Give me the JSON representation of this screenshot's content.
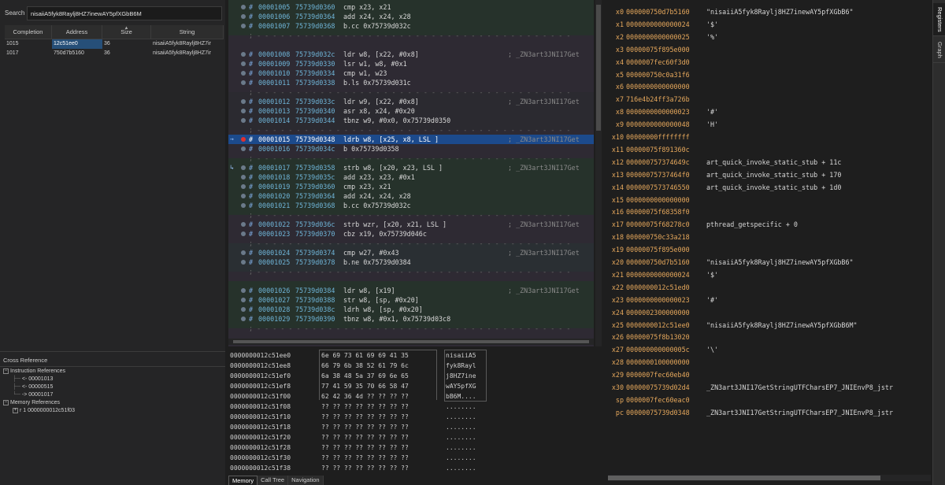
{
  "search": {
    "label": "Search",
    "value": "nisaiiA5fyk8Raylj8HZ7inewAY5pfXGbB6M"
  },
  "results": {
    "columns": [
      "Completion",
      "Address",
      "Size",
      "String"
    ],
    "rows": [
      {
        "completion": "1015",
        "address": "12c51ee0",
        "size": "36",
        "string": "nisaiiA5fyk8Raylj8HZ7ir"
      },
      {
        "completion": "1017",
        "address": "750d7b5160",
        "size": "36",
        "string": "nisaiiA5fyk8Raylj8HZ7ir"
      }
    ]
  },
  "xref": {
    "title": "Cross Reference",
    "instr_refs": "Instruction References",
    "instr_items": [
      "<- 00001013",
      "<- 00000515",
      "-> 00001017"
    ],
    "mem_refs": "Memory References",
    "mem_items": [
      "r 1 0000000012c51f03"
    ]
  },
  "disasm": [
    {
      "kind": "ins",
      "n": "00001005",
      "a": "75739d0360",
      "i": "cmp x23, x21",
      "c": ""
    },
    {
      "kind": "ins",
      "n": "00001006",
      "a": "75739d0364",
      "i": "add x24, x24, x28",
      "c": ""
    },
    {
      "kind": "ins",
      "n": "00001007",
      "a": "75739d0368",
      "i": "b.cc 0x75739d032c",
      "c": ""
    },
    {
      "kind": "sep"
    },
    {
      "kind": "blank"
    },
    {
      "kind": "ins",
      "n": "00001008",
      "a": "75739d032c",
      "i": "ldr w8, [x22, #0x8]",
      "c": "; _ZN3art3JNI17Get"
    },
    {
      "kind": "ins",
      "n": "00001009",
      "a": "75739d0330",
      "i": "lsr w1, w8, #0x1",
      "c": ""
    },
    {
      "kind": "ins",
      "n": "00001010",
      "a": "75739d0334",
      "i": "cmp w1, w23",
      "c": ""
    },
    {
      "kind": "ins",
      "n": "00001011",
      "a": "75739d0338",
      "i": "b.ls 0x75739d031c",
      "c": ""
    },
    {
      "kind": "sep"
    },
    {
      "kind": "ins",
      "n": "00001012",
      "a": "75739d033c",
      "i": "ldr w9, [x22, #0x8]",
      "c": "; _ZN3art3JNI17Get"
    },
    {
      "kind": "ins",
      "n": "00001013",
      "a": "75739d0340",
      "i": "asr x8, x24, #0x20",
      "c": ""
    },
    {
      "kind": "ins",
      "n": "00001014",
      "a": "75739d0344",
      "i": "tbnz w9, #0x0, 0x75739d0350",
      "c": ""
    },
    {
      "kind": "sep"
    },
    {
      "kind": "ins",
      "n": "00001015",
      "a": "75739d0348",
      "i": "ldrb w8, [x25, x8, LSL ]",
      "c": "; _ZN3art3JNI17Get",
      "sel": true
    },
    {
      "kind": "ins",
      "n": "00001016",
      "a": "75739d034c",
      "i": "b 0x75739d0358",
      "c": ""
    },
    {
      "kind": "sep"
    },
    {
      "kind": "ins",
      "n": "00001017",
      "a": "75739d0358",
      "i": "strb w8, [x20, x23, LSL ]",
      "c": "; _ZN3art3JNI17Get"
    },
    {
      "kind": "ins",
      "n": "00001018",
      "a": "75739d035c",
      "i": "add x23, x23, #0x1",
      "c": ""
    },
    {
      "kind": "ins",
      "n": "00001019",
      "a": "75739d0360",
      "i": "cmp x23, x21",
      "c": ""
    },
    {
      "kind": "ins",
      "n": "00001020",
      "a": "75739d0364",
      "i": "add x24, x24, x28",
      "c": ""
    },
    {
      "kind": "ins",
      "n": "00001021",
      "a": "75739d0368",
      "i": "b.cc 0x75739d032c",
      "c": ""
    },
    {
      "kind": "sep"
    },
    {
      "kind": "ins",
      "n": "00001022",
      "a": "75739d036c",
      "i": "strb wzr, [x20, x21, LSL ]",
      "c": "; _ZN3art3JNI17Get"
    },
    {
      "kind": "ins",
      "n": "00001023",
      "a": "75739d0370",
      "i": "cbz x19, 0x75739d046c",
      "c": ""
    },
    {
      "kind": "sep"
    },
    {
      "kind": "ins",
      "n": "00001024",
      "a": "75739d0374",
      "i": "cmp w27, #0x43",
      "c": "; _ZN3art3JNI17Get"
    },
    {
      "kind": "ins",
      "n": "00001025",
      "a": "75739d0378",
      "i": "b.ne 0x75739d0384",
      "c": ""
    },
    {
      "kind": "sep"
    },
    {
      "kind": "blank"
    },
    {
      "kind": "ins",
      "n": "00001026",
      "a": "75739d0384",
      "i": "ldr w8, [x19]",
      "c": "; _ZN3art3JNI17Get"
    },
    {
      "kind": "ins",
      "n": "00001027",
      "a": "75739d0388",
      "i": "str w8, [sp, #0x20]",
      "c": ""
    },
    {
      "kind": "ins",
      "n": "00001028",
      "a": "75739d038c",
      "i": "ldrh w8, [sp, #0x20]",
      "c": ""
    },
    {
      "kind": "ins",
      "n": "00001029",
      "a": "75739d0390",
      "i": "tbnz w8, #0x1, 0x75739d03c8",
      "c": ""
    },
    {
      "kind": "sep"
    }
  ],
  "memory": {
    "rows": [
      {
        "addr": "0000000012c51ee0",
        "hex": "6e 69 73 61 69 69 41 35",
        "ascii": "nisaiiA5"
      },
      {
        "addr": "0000000012c51ee8",
        "hex": "66 79 6b 38 52 61 79 6c",
        "ascii": "fyk8Rayl"
      },
      {
        "addr": "0000000012c51ef0",
        "hex": "6a 38 48 5a 37 69 6e 65",
        "ascii": "j8HZ7ine"
      },
      {
        "addr": "0000000012c51ef8",
        "hex": "77 41 59 35 70 66 58 47",
        "ascii": "wAY5pfXG"
      },
      {
        "addr": "0000000012c51f00",
        "hex": "62 42 36 4d ?? ?? ?? ??",
        "ascii": "bB6M...."
      },
      {
        "addr": "0000000012c51f08",
        "hex": "?? ?? ?? ?? ?? ?? ?? ??",
        "ascii": "........"
      },
      {
        "addr": "0000000012c51f10",
        "hex": "?? ?? ?? ?? ?? ?? ?? ??",
        "ascii": "........"
      },
      {
        "addr": "0000000012c51f18",
        "hex": "?? ?? ?? ?? ?? ?? ?? ??",
        "ascii": "........"
      },
      {
        "addr": "0000000012c51f20",
        "hex": "?? ?? ?? ?? ?? ?? ?? ??",
        "ascii": "........"
      },
      {
        "addr": "0000000012c51f28",
        "hex": "?? ?? ?? ?? ?? ?? ?? ??",
        "ascii": "........"
      },
      {
        "addr": "0000000012c51f30",
        "hex": "?? ?? ?? ?? ?? ?? ?? ??",
        "ascii": "........"
      },
      {
        "addr": "0000000012c51f38",
        "hex": "?? ?? ?? ?? ?? ?? ?? ??",
        "ascii": "........"
      }
    ],
    "tabs": [
      "Memory",
      "Call Tree",
      "Navigation"
    ]
  },
  "registers": [
    {
      "name": "x0",
      "value": "000000750d7b5160",
      "desc": "\"nisaiiA5fyk8Raylj8HZ7inewAY5pfXGbB6\""
    },
    {
      "name": "x1",
      "value": "0000000000000024",
      "desc": "'$'"
    },
    {
      "name": "x2",
      "value": "0000000000000025",
      "desc": "'%'"
    },
    {
      "name": "x3",
      "value": "00000075f895e000",
      "desc": ""
    },
    {
      "name": "x4",
      "value": "0000007fec60f3d0",
      "desc": ""
    },
    {
      "name": "x5",
      "value": "000000750c0a31f6",
      "desc": ""
    },
    {
      "name": "x6",
      "value": "0000000000000000",
      "desc": ""
    },
    {
      "name": "x7",
      "value": "716e4b24ff3a726b",
      "desc": ""
    },
    {
      "name": "x8",
      "value": "0000000000000023",
      "desc": "'#'"
    },
    {
      "name": "x9",
      "value": "0000000000000048",
      "desc": "'H'"
    },
    {
      "name": "x10",
      "value": "00000000ffffffff",
      "desc": ""
    },
    {
      "name": "x11",
      "value": "00000075f891360c",
      "desc": ""
    },
    {
      "name": "x12",
      "value": "000000757374649c",
      "desc": "art_quick_invoke_static_stub + 11c"
    },
    {
      "name": "x13",
      "value": "00000075737464f0",
      "desc": "art_quick_invoke_static_stub + 170"
    },
    {
      "name": "x14",
      "value": "0000007573746550",
      "desc": "art_quick_invoke_static_stub + 1d0"
    },
    {
      "name": "x15",
      "value": "0000000000000000",
      "desc": ""
    },
    {
      "name": "x16",
      "value": "00000075f68358f0",
      "desc": ""
    },
    {
      "name": "x17",
      "value": "00000075f68278c0",
      "desc": "pthread_getspecific + 0"
    },
    {
      "name": "x18",
      "value": "000000750c33a218",
      "desc": ""
    },
    {
      "name": "x19",
      "value": "00000075f895e000",
      "desc": ""
    },
    {
      "name": "x20",
      "value": "000000750d7b5160",
      "desc": "\"nisaiiA5fyk8Raylj8HZ7inewAY5pfXGbB6\""
    },
    {
      "name": "x21",
      "value": "0000000000000024",
      "desc": "'$'"
    },
    {
      "name": "x22",
      "value": "0000000012c51ed0",
      "desc": ""
    },
    {
      "name": "x23",
      "value": "0000000000000023",
      "desc": "'#'"
    },
    {
      "name": "x24",
      "value": "0000002300000000",
      "desc": ""
    },
    {
      "name": "x25",
      "value": "0000000012c51ee0",
      "desc": "\"nisaiiA5fyk8Raylj8HZ7inewAY5pfXGbB6M\""
    },
    {
      "name": "x26",
      "value": "00000075f8b13020",
      "desc": ""
    },
    {
      "name": "x27",
      "value": "000000000000005c",
      "desc": "'\\'"
    },
    {
      "name": "x28",
      "value": "0000000100000000",
      "desc": ""
    },
    {
      "name": "x29",
      "value": "0000007fec60eb40",
      "desc": ""
    },
    {
      "name": "x30",
      "value": "00000075739d02d4",
      "desc": "_ZN3art3JNI17GetStringUTFCharsEP7_JNIEnvP8_jstr"
    },
    {
      "name": "sp",
      "value": "0000007fec60eac0",
      "desc": ""
    },
    {
      "name": "pc",
      "value": "00000075739d0348",
      "desc": "_ZN3art3JNI17GetStringUTFCharsEP7_JNIEnvP8_jstr"
    }
  ],
  "side_tabs": [
    "Registers",
    "Graph"
  ],
  "colors": {
    "selection": "#1c4a8c",
    "register_value": "#e6a85c",
    "breakpoint": "#e03030",
    "address": "#6fb5d8"
  }
}
